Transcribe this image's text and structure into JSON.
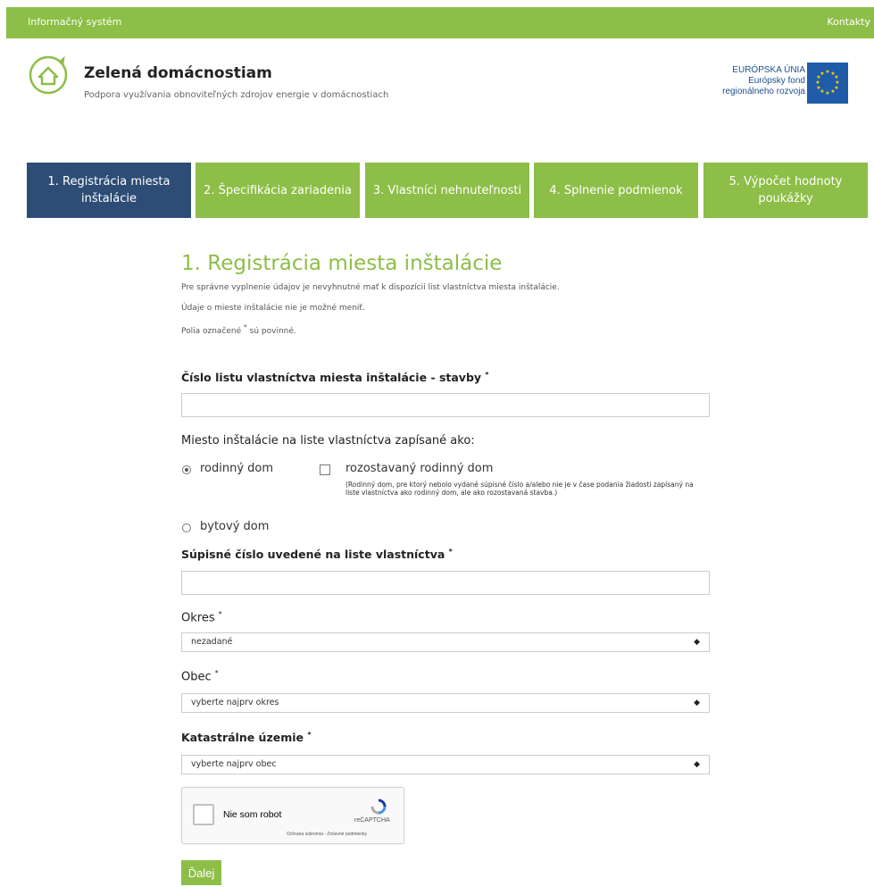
{
  "topbar": {
    "left_link": "Informačný systém",
    "right_link": "Kontakty"
  },
  "header": {
    "title": "Zelená domácnostiam",
    "subtitle": "Podpora využívania obnoviteľných zdrojov energie v domácnostiach",
    "eu": {
      "line1": "EURÓPSKA ÚNIA",
      "line2": "Európsky fond",
      "line3": "regionálneho rozvoja"
    }
  },
  "steps": [
    {
      "label": "1. Registrácia miesta inštalácie",
      "active": true
    },
    {
      "label": "2. Špecifikácia zariadenia",
      "active": false
    },
    {
      "label": "3. Vlastníci nehnuteľnosti",
      "active": false
    },
    {
      "label": "4. Splnenie podmienok",
      "active": false
    },
    {
      "label": "5. Výpočet hodnoty poukážky",
      "active": false
    }
  ],
  "form": {
    "heading": "1. Registrácia miesta inštalácie",
    "intro1": "Pre správne vyplnenie údajov je nevyhnutné mať k dispozícii list vlastníctva miesta inštalácie.",
    "intro2": "Údaje o mieste inštalácie nie je možné meniť.",
    "intro3_pre": "Polia označené ",
    "intro3_star": "*",
    "intro3_post": " sú povinné.",
    "required_mark": "*",
    "lv_label": "Číslo listu vlastníctva miesta inštalácie - stavby",
    "lv_value": "",
    "type_label": "Miesto inštalácie na liste vlastníctva zapísané ako:",
    "opt_rodinny": "rodinný dom",
    "opt_rozostavany": "rozostavaný rodinný dom",
    "opt_rozostavany_note": "(Rodinný dom, pre ktorý nebolo vydané súpisné číslo a/alebo nie je v čase podania žiadosti zapísaný na liste vlastníctva ako rodinný dom, ale ako rozostavaná stavba.)",
    "opt_bytovy": "bytový dom",
    "supisne_label": "Súpisné číslo uvedené na liste vlastníctva",
    "supisne_value": "",
    "okres_label": "Okres",
    "okres_value": "nezadané",
    "obec_label": "Obec",
    "obec_value": "vyberte najprv okres",
    "kat_label": "Katastrálne územie",
    "kat_value": "vyberte najprv obec",
    "submit": "Ďalej"
  },
  "recaptcha": {
    "label": "Nie som robot",
    "brand": "reCAPTCHA",
    "terms": "Ochrana súkromia - Zmluvné podmienky"
  },
  "colors": {
    "green": "#8dbe47",
    "navy": "#2d4d77"
  }
}
